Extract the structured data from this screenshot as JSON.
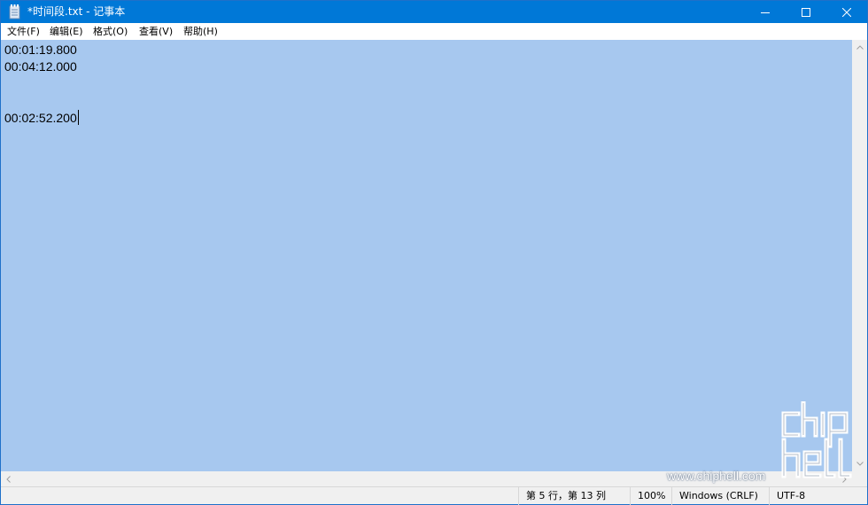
{
  "window": {
    "title": "*时间段.txt - 记事本",
    "accent_color": "#0078d7",
    "controls": {
      "minimize_icon": "minimize-icon",
      "maximize_icon": "maximize-icon",
      "close_icon": "close-icon"
    }
  },
  "menu": {
    "items": [
      "文件(F)",
      "编辑(E)",
      "格式(O)",
      "查看(V)",
      "帮助(H)"
    ]
  },
  "editor": {
    "selection_color": "#a7c8ef",
    "lines": [
      "00:01:19.800",
      "00:04:12.000",
      "",
      "",
      "00:02:52.200"
    ]
  },
  "statusbar": {
    "position": "第 5 行，第 13 列",
    "zoom": "100%",
    "line_ending": "Windows (CRLF)",
    "encoding": "UTF-8"
  },
  "watermark": {
    "url": "www.chiphell.com"
  }
}
